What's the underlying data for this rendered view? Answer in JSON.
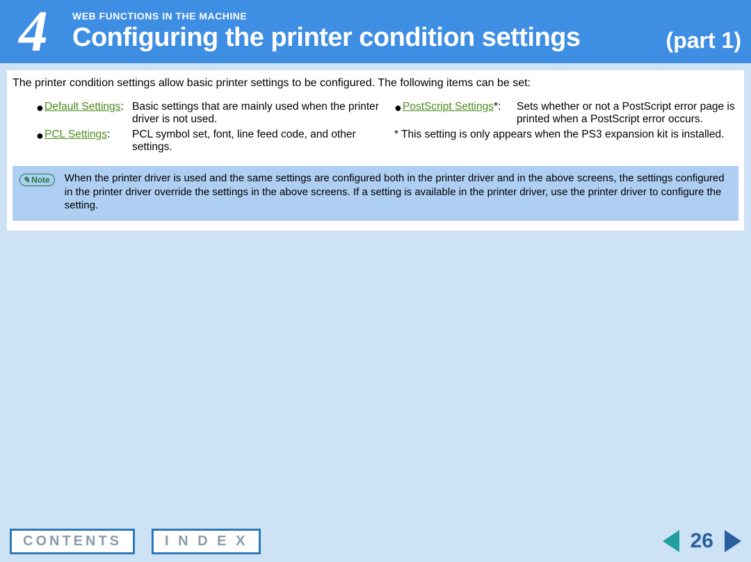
{
  "header": {
    "chapter_number": "4",
    "section_label": "WEB FUNCTIONS IN THE MACHINE",
    "title": "Configuring the printer condition settings",
    "part": "(part 1)"
  },
  "intro": "The printer condition settings allow basic printer settings to be configured. The following items can be set:",
  "left_items": [
    {
      "link": "Default Settings",
      "suffix": ":",
      "desc": "Basic settings that are mainly used when the printer driver is not used."
    },
    {
      "link": "PCL Settings",
      "suffix": ":",
      "desc": "PCL symbol set, font, line feed code, and other settings."
    }
  ],
  "right_items": [
    {
      "link": "PostScript Settings",
      "star": "*",
      "suffix": ":",
      "desc": "Sets whether or not a PostScript error page is printed when a PostScript error occurs."
    }
  ],
  "footnote": {
    "star": "*",
    "text": "This setting is only appears when the PS3 expansion kit is installed."
  },
  "note": {
    "badge_icon": "✎",
    "badge_label": "Note",
    "text": "When the printer driver is used and the same settings are configured both in the printer driver and in the above screens, the settings configured in the printer driver override the settings in the above screens. If a setting is available in the printer driver, use the printer driver to configure the setting."
  },
  "footer": {
    "contents": "CONTENTS",
    "index": "I N D E X",
    "page_number": "26"
  }
}
